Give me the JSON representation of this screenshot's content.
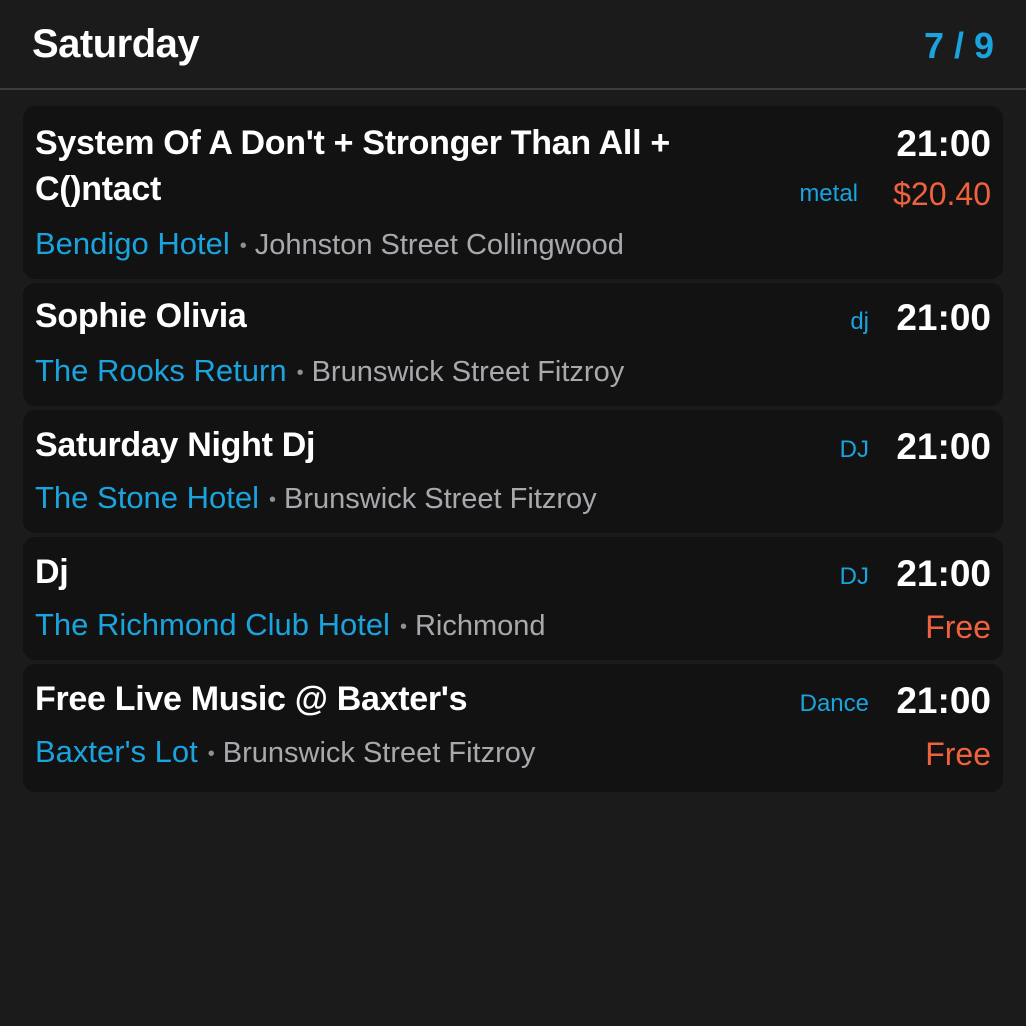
{
  "header": {
    "day": "Saturday",
    "date": "7 / 9"
  },
  "colors": {
    "background": "#1b1b1c",
    "card": "#121212",
    "accent": "#1aa3dc",
    "price": "#f0613e",
    "muted": "#a7a9ad"
  },
  "events": [
    {
      "title": "System Of A Don't + Stronger Than All + C()ntact",
      "venue": "Bendigo Hotel",
      "area": "Johnston Street Collingwood",
      "genre": "metal",
      "time": "21:00",
      "price": "$20.40"
    },
    {
      "title": "Sophie Olivia",
      "venue": "The Rooks Return",
      "area": "Brunswick Street Fitzroy",
      "genre": "dj",
      "time": "21:00",
      "price": ""
    },
    {
      "title": "Saturday Night Dj",
      "venue": "The Stone Hotel",
      "area": "Brunswick Street Fitzroy",
      "genre": "DJ",
      "time": "21:00",
      "price": ""
    },
    {
      "title": "Dj",
      "venue": "The Richmond Club Hotel",
      "area": "Richmond",
      "genre": "DJ",
      "time": "21:00",
      "price": "Free"
    },
    {
      "title": "Free Live Music @ Baxter's",
      "venue": "Baxter's Lot",
      "area": "Brunswick Street Fitzroy",
      "genre": "Dance",
      "time": "21:00",
      "price": "Free"
    }
  ],
  "separator": "•"
}
